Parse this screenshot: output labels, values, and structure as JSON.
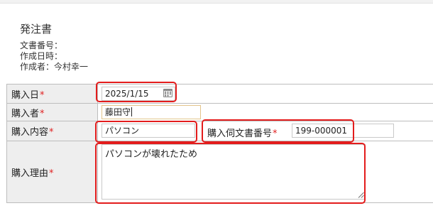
{
  "document": {
    "title": "発注書",
    "doc_number_label": "文書番号：",
    "created_date_label": "作成日時：",
    "author_label": "作成者：今村幸一"
  },
  "form": {
    "required_mark": "*",
    "purchase_date": {
      "label": "購入日",
      "value": "2025/1/15"
    },
    "purchaser": {
      "label": "購入者",
      "value": "藤田守"
    },
    "purchase_content": {
      "label": "購入内容",
      "value": "パソコン"
    },
    "inquiry_doc_number": {
      "label": "購入伺文書番号",
      "value": "199-000001"
    },
    "purchase_reason": {
      "label": "購入理由",
      "value": "パソコンが壊れたため"
    }
  },
  "colors": {
    "highlight": "#e31c1c",
    "required": "#e02020",
    "label_background": "#eeeeee"
  },
  "icons": {
    "date_picker": "calendar-icon",
    "textarea_resize": "resize-grip-icon"
  }
}
